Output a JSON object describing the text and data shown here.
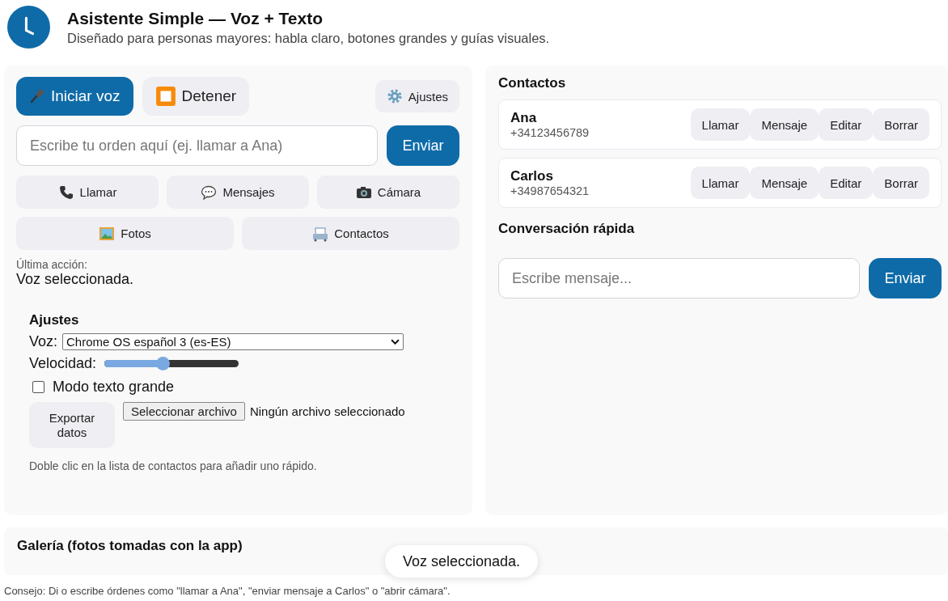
{
  "header": {
    "title": "Asistente Simple — Voz + Texto",
    "subtitle": "Diseñado para personas mayores: habla claro, botones grandes y guías visuales."
  },
  "controls": {
    "start_voice": "Iniciar voz",
    "stop": "Detener",
    "settings": "Ajustes"
  },
  "command": {
    "placeholder": "Escribe tu orden aquí (ej. llamar a Ana)",
    "send": "Enviar"
  },
  "shortcuts": [
    {
      "kind": "phone",
      "label": "Llamar"
    },
    {
      "kind": "chat",
      "label": "Mensajes"
    },
    {
      "kind": "camera",
      "label": "Cámara"
    },
    {
      "kind": "photo",
      "label": "Fotos"
    },
    {
      "kind": "contacts",
      "label": "Contactos"
    }
  ],
  "last_action": {
    "label": "Última acción:",
    "value": "Voz seleccionada."
  },
  "settings": {
    "title": "Ajustes",
    "voice_label": "Voz:",
    "voice": "Chrome OS español 3 (es-ES)",
    "speed_label": "Velocidad:",
    "speed": {
      "level": 0.44
    },
    "large_text": {
      "label": "Modo texto grande",
      "checked": false
    },
    "export": "Exportar datos",
    "file_button": "Seleccionar archivo",
    "file_status": "Ningún archivo seleccionado",
    "hint": "Doble clic en la lista de contactos para añadir uno rápido."
  },
  "contacts": {
    "title": "Contactos",
    "items": [
      {
        "name": "Ana",
        "phone": "+34123456789",
        "actions": [
          "Llamar",
          "Mensaje",
          "Editar",
          "Borrar"
        ]
      },
      {
        "name": "Carlos",
        "phone": "+34987654321",
        "actions": [
          "Llamar",
          "Mensaje",
          "Editar",
          "Borrar"
        ]
      }
    ]
  },
  "quick_chat": {
    "title": "Conversación rápida",
    "placeholder": "Escribe mensaje...",
    "send": "Enviar"
  },
  "gallery": {
    "title": "Galería (fotos tomadas con la app)"
  },
  "toast": "Voz seleccionada.",
  "tip": "Consejo: Di o escribe órdenes como \"llamar a Ana\", \"enviar mensaje a Carlos\" o \"abrir cámara\"."
}
